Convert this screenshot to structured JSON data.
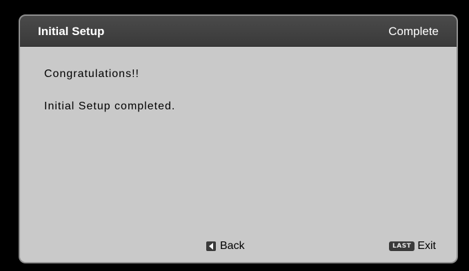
{
  "header": {
    "title": "Initial Setup",
    "status": "Complete"
  },
  "messages": {
    "line1": "Congratulations!!",
    "line2": "Initial Setup completed."
  },
  "footer": {
    "back": {
      "icon": "left-arrow-key-icon",
      "label": "Back"
    },
    "exit": {
      "key_label": "LAST",
      "label": "Exit"
    }
  },
  "colors": {
    "background": "#000000",
    "dialog": "#c9c9c9",
    "header": "#3f3f3f",
    "header_text": "#ffffff"
  }
}
